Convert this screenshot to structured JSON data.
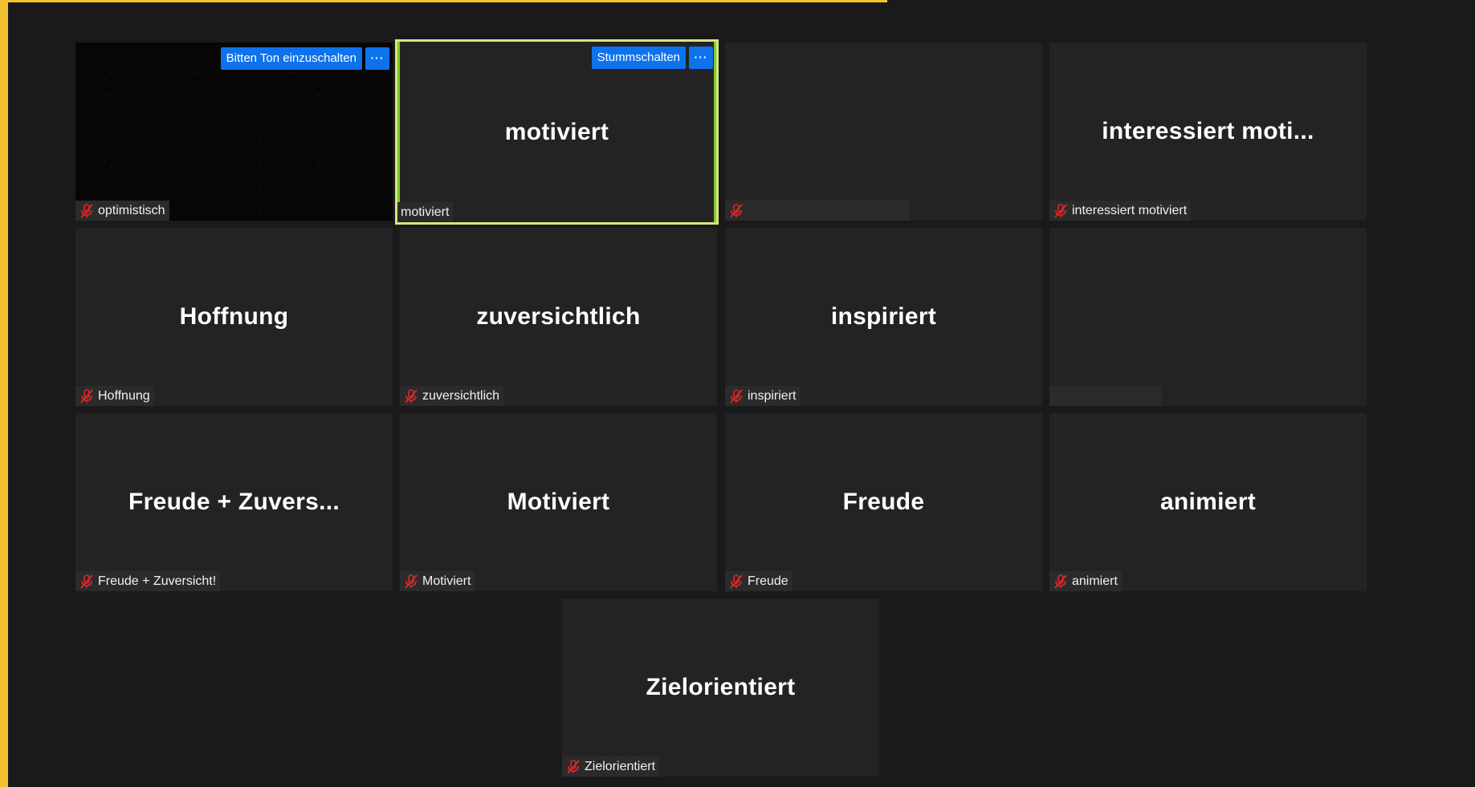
{
  "tiles": [
    {
      "id": "t1",
      "display_text": "",
      "name_tag": "optimistisch",
      "muted": true,
      "video": true
    },
    {
      "id": "t2",
      "display_text": "motiviert",
      "name_tag": "motiviert",
      "muted": false,
      "active_speaker": true
    },
    {
      "id": "t3",
      "display_text": "",
      "name_tag": "",
      "muted": true
    },
    {
      "id": "t4",
      "display_text": "interessiert  moti...",
      "name_tag": "interessiert motiviert",
      "muted": true
    },
    {
      "id": "t5",
      "display_text": "Hoffnung",
      "name_tag": "Hoffnung",
      "muted": true
    },
    {
      "id": "t6",
      "display_text": "zuversichtlich",
      "name_tag": "zuversichtlich",
      "muted": true
    },
    {
      "id": "t7",
      "display_text": "inspiriert",
      "name_tag": "inspiriert",
      "muted": true
    },
    {
      "id": "t8",
      "display_text": "",
      "name_tag": "",
      "muted": false
    },
    {
      "id": "t9",
      "display_text": "Freude  +  Zuvers...",
      "name_tag": "Freude + Zuversicht!",
      "muted": true
    },
    {
      "id": "t10",
      "display_text": "Motiviert",
      "name_tag": "Motiviert",
      "muted": true
    },
    {
      "id": "t11",
      "display_text": "Freude",
      "name_tag": "Freude",
      "muted": true
    },
    {
      "id": "t12",
      "display_text": "animiert",
      "name_tag": "animiert",
      "muted": true
    },
    {
      "id": "t13",
      "display_text": "Zielorientiert",
      "name_tag": "Zielorientiert",
      "muted": true
    }
  ],
  "controls": {
    "ask_unmute_label": "Bitten Ton einzuschalten",
    "mute_label": "Stummschalten",
    "more_label": "···"
  },
  "colors": {
    "background": "#1a1a1a",
    "tile": "#232323",
    "button": "#0e72ed",
    "mute_icon": "#e02828",
    "active_speaker": "#d6e57f",
    "share_border": "#f2c230"
  },
  "icons": {
    "muted_mic": "muted-microphone-icon",
    "more": "more-options-icon"
  }
}
